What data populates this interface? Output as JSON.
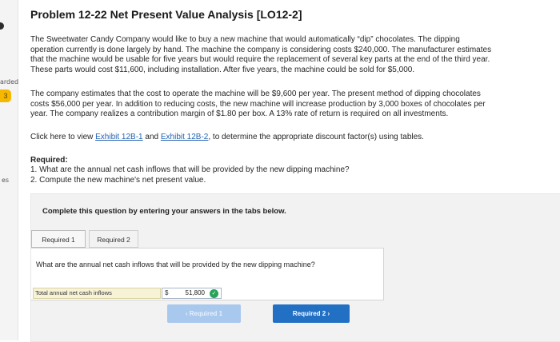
{
  "left_strip": {
    "labels": [
      "arded",
      "es"
    ],
    "badge": "3"
  },
  "title": "Problem 12-22 Net Present Value Analysis [LO12-2]",
  "paragraph1": [
    "The Sweetwater Candy Company would like to buy a new machine that would automatically “dip” chocolates. The dipping",
    "operation currently is done largely by hand. The machine the company is considering costs $240,000. The manufacturer estimates",
    "that the machine would be usable for five years but would require the replacement of several key parts at the end of the third year.",
    "These parts would cost $11,600, including installation. After five years, the machine could be sold for $5,000."
  ],
  "paragraph2": [
    "The company estimates that the cost to operate the machine will be $9,600 per year. The present method of dipping chocolates",
    "costs $56,000 per year. In addition to reducing costs, the new machine will increase production by 3,000 boxes of chocolates per",
    "year. The company realizes a contribution margin of $1.80 per box. A 13% rate of return is required on all investments."
  ],
  "click_line": {
    "before": "Click here to view ",
    "link1": "Exhibit 12B-1",
    "middle": " and ",
    "link2": "Exhibit 12B-2",
    "after": ", to determine the appropriate discount factor(s) using tables."
  },
  "required": {
    "heading": "Required:",
    "items": [
      "1. What are the annual net cash inflows that will be provided by the new dipping machine?",
      "2. Compute the new machine's net present value."
    ]
  },
  "panel": {
    "instruction": "Complete this question by entering your answers in the tabs below.",
    "tabs": [
      "Required 1",
      "Required 2"
    ],
    "question": "What are the annual net cash inflows that will be provided by the new dipping machine?",
    "answer_label": "Total annual net cash inflows",
    "currency": "$",
    "answer_value": "51,800",
    "prev_label": "‹  Required 1",
    "next_label": "Required 2  ›"
  },
  "colors": {
    "link": "#2563b3",
    "next_button": "#2270c4",
    "prev_button_disabled": "#a8c8ee",
    "check": "#27a35a",
    "badge": "#f5b800"
  }
}
